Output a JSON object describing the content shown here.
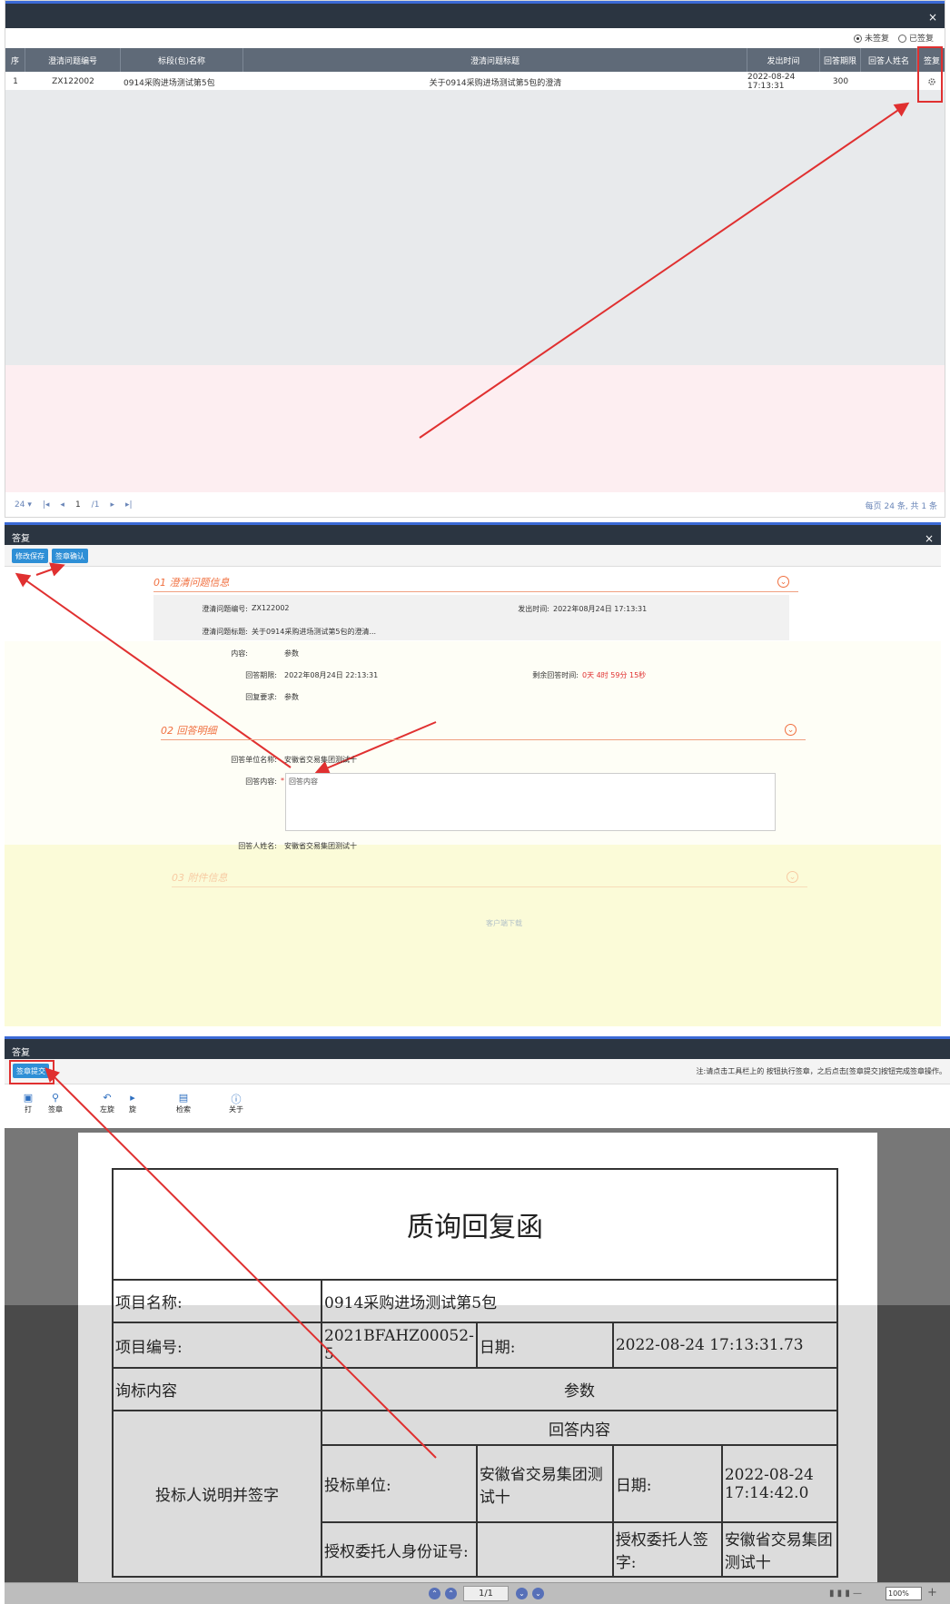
{
  "panel1": {
    "close_label": "×",
    "radio_unsigned": "未签复",
    "radio_signed": "已签复",
    "columns": [
      "序",
      "澄清问题编号",
      "标段(包)名称",
      "澄清问题标题",
      "发出时间",
      "回答期限",
      "回答人姓名",
      "签复"
    ],
    "row": {
      "seq": "1",
      "code": "ZX122002",
      "section": "0914采购进场测试第5包",
      "title": "关于0914采购进场测试第5包的澄清",
      "time": "2022-08-24 17:13:31",
      "deadline": "300",
      "name": "",
      "sign_icon": "gear-icon"
    },
    "pager": {
      "size": "24 ▾",
      "first": "|◂",
      "prev": "◂",
      "page": "1",
      "total": "/1",
      "next": "▸",
      "last": "▸|",
      "summary": "每页 24 条, 共 1 条"
    }
  },
  "panel2": {
    "title": "答复",
    "close_label": "×",
    "btn_save": "修改保存",
    "btn_sign": "签章确认",
    "sec1": "01 澄清问题信息",
    "sec2": "02 回答明细",
    "sec3": "03 附件信息",
    "chev": "⌄",
    "labels": {
      "code": "澄清问题编号:",
      "code_val": "ZX122002",
      "time": "发出时间:",
      "time_val": "2022年08月24日 17:13:31",
      "title": "澄清问题标题:",
      "title_val": "关于0914采购进场测试第5包的澄清...",
      "content": "内容:",
      "content_val": "参数",
      "deadline": "回答期限:",
      "deadline_val": "2022年08月24日 22:13:31",
      "remain": "剩余回答时间:",
      "remain_val": "0天 4时 59分 15秒",
      "req": "回复要求:",
      "req_val": "参数",
      "unit": "回答单位名称:",
      "unit_val": "安徽省交易集团测试十",
      "answer": "回答内容:",
      "required_mark": "*",
      "answer_placeholder": "回答内容",
      "person": "回答人姓名:",
      "person_val": "安徽省交易集团测试十",
      "attach": "客户端下载"
    }
  },
  "panel3": {
    "title": "答复",
    "btn_submit": "签章提交",
    "note": "注:请点击工具栏上的 按钮执行签章，之后点击[签章提交]按钮完成签章操作。",
    "tools": [
      {
        "label": "打",
        "icon": "print-icon"
      },
      {
        "label": "签章",
        "icon": "seal-icon"
      },
      {
        "label": "左旋",
        "icon": "rotate-left-icon"
      },
      {
        "label": "旋",
        "icon": "rotate-right-icon"
      },
      {
        "label": "检索",
        "icon": "search-icon"
      },
      {
        "label": "关于",
        "icon": "info-icon"
      }
    ],
    "doc": {
      "heading": "质询回复函",
      "project_name_label": "项目名称:",
      "project_name": "0914采购进场测试第5包",
      "project_code_label": "项目编号:",
      "project_code": "2021BFAHZ00052-5",
      "date_label": "日期:",
      "date": "2022-08-24 17:13:31.73",
      "inquiry_label": "询标内容",
      "inquiry": "参数",
      "answer_label": "回答内容",
      "bidder_label": "投标人说明并签字",
      "bid_unit_label": "投标单位:",
      "bid_unit": "安徽省交易集团测试十",
      "date2_label": "日期:",
      "date2": "2022-08-24 17:14:42.0",
      "id_label": "授权委托人身份证号:",
      "id_val": "",
      "sign_label": "授权委托人签字:",
      "sign_val": "安徽省交易集团测试十"
    },
    "status": {
      "page": "1/1",
      "zoom": "100%"
    }
  }
}
